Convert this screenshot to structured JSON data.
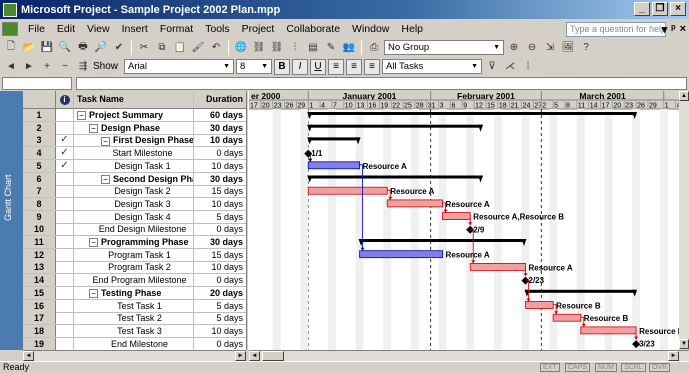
{
  "window": {
    "title": "Microsoft Project - Sample Project 2002 Plan.mpp"
  },
  "menu": [
    "File",
    "Edit",
    "View",
    "Insert",
    "Format",
    "Tools",
    "Project",
    "Collaborate",
    "Window",
    "Help"
  ],
  "help_placeholder": "Type a question for help",
  "toolbar": {
    "group": "No Group",
    "font": "Arial",
    "size": "8",
    "filter": "All Tasks",
    "show": "Show"
  },
  "view_bar": {
    "label": "Gantt Chart"
  },
  "table": {
    "headers": {
      "name": "Task Name",
      "duration": "Duration"
    },
    "rows": [
      {
        "id": "1",
        "name": "Project Summary",
        "dur": "60 days",
        "level": 0,
        "summary": true
      },
      {
        "id": "2",
        "name": "Design Phase",
        "dur": "30 days",
        "level": 1,
        "summary": true
      },
      {
        "id": "3",
        "name": "First Design Phase",
        "dur": "10 days",
        "level": 2,
        "summary": true,
        "check": true
      },
      {
        "id": "4",
        "name": "Start Milestone",
        "dur": "0 days",
        "level": 3,
        "check": true
      },
      {
        "id": "5",
        "name": "Design Task 1",
        "dur": "10 days",
        "level": 3,
        "check": true
      },
      {
        "id": "6",
        "name": "Second Design Phase",
        "dur": "30 days",
        "level": 2,
        "summary": true
      },
      {
        "id": "7",
        "name": "Design Task 2",
        "dur": "15 days",
        "level": 3
      },
      {
        "id": "8",
        "name": "Design Task 3",
        "dur": "10 days",
        "level": 3
      },
      {
        "id": "9",
        "name": "Design Task 4",
        "dur": "5 days",
        "level": 3
      },
      {
        "id": "10",
        "name": "End Design Milestone",
        "dur": "0 days",
        "level": 3
      },
      {
        "id": "11",
        "name": "Programming Phase",
        "dur": "30 days",
        "level": 1,
        "summary": true
      },
      {
        "id": "12",
        "name": "Program Task 1",
        "dur": "15 days",
        "level": 2
      },
      {
        "id": "13",
        "name": "Program Task 2",
        "dur": "10 days",
        "level": 2
      },
      {
        "id": "14",
        "name": "End Program Milestone",
        "dur": "0 days",
        "level": 2
      },
      {
        "id": "15",
        "name": "Testing Phase",
        "dur": "20 days",
        "level": 1,
        "summary": true
      },
      {
        "id": "16",
        "name": "Test Task 1",
        "dur": "5 days",
        "level": 2
      },
      {
        "id": "17",
        "name": "Test Task 2",
        "dur": "5 days",
        "level": 2
      },
      {
        "id": "18",
        "name": "Test Task 3",
        "dur": "10 days",
        "level": 2
      },
      {
        "id": "19",
        "name": "End Milestone",
        "dur": "0 days",
        "level": 2
      }
    ]
  },
  "timescale": {
    "months": [
      "er 2000",
      "January 2001",
      "February 2001",
      "March 2001"
    ],
    "days": [
      "17",
      "20",
      "23",
      "26",
      "29",
      "1",
      "4",
      "7",
      "10",
      "13",
      "16",
      "19",
      "22",
      "25",
      "28",
      "31",
      "3",
      "6",
      "9",
      "12",
      "15",
      "18",
      "21",
      "24",
      "27",
      "2",
      "5",
      "8",
      "11",
      "14",
      "17",
      "20",
      "23",
      "26",
      "29",
      "1",
      "4"
    ]
  },
  "gantt_labels": {
    "r4": "1/1",
    "r5": "Resource A",
    "r7": "Resource A",
    "r8": "Resource A",
    "r9": "Resource A,Resource B",
    "r10": "2/9",
    "r12": "Resource A",
    "r13": "Resource A",
    "r14": "2/23",
    "r16": "Resource B",
    "r17": "Resource B",
    "r18": "Resource B",
    "r19": "3/23"
  },
  "status": {
    "text": "Ready",
    "indicators": [
      "EXT",
      "CAPS",
      "NUM",
      "SCRL",
      "OVR"
    ]
  }
}
